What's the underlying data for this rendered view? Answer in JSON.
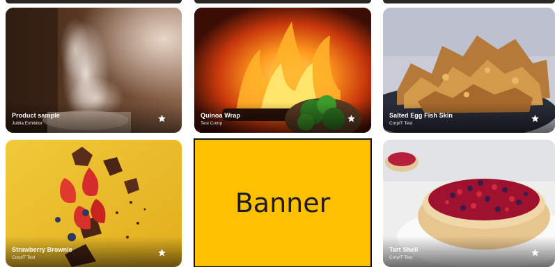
{
  "cards": [
    {
      "title": "Product sample",
      "subtitle": "Jublia Exhibitor",
      "icon": "star-icon"
    },
    {
      "title": "Quinoa Wrap",
      "subtitle": "Test Comp",
      "icon": "star-icon"
    },
    {
      "title": "Salted Egg Fish Skin",
      "subtitle": "CorpIT Test",
      "icon": "star-icon"
    },
    {
      "title": "Strawberry Brownie",
      "subtitle": "CorpIT Test",
      "icon": "star-icon"
    },
    {
      "title": "Tart Shell",
      "subtitle": "CorpIT Test",
      "icon": "star-icon"
    }
  ],
  "banner": {
    "label": "Banner",
    "color": "#ffc000"
  }
}
